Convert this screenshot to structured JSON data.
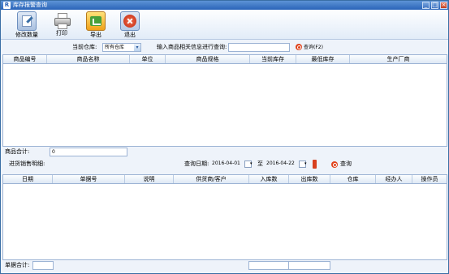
{
  "window": {
    "title": "库存报警查询"
  },
  "toolbar": {
    "edit_label": "修改数量",
    "print_label": "打印",
    "export_label": "导出",
    "exit_label": "退出"
  },
  "filter": {
    "warehouse_label": "当前仓库:",
    "warehouse_value": "所有仓库",
    "search_prompt": "输入商品相关信息进行查询:",
    "search_value": "",
    "search_button": "查询(F2)"
  },
  "product_table": {
    "columns": [
      "商品编号",
      "商品名称",
      "单位",
      "商品规格",
      "当前库存",
      "最低库存",
      "生产厂商"
    ],
    "total_label": "商品合计:",
    "total_value": "0"
  },
  "detail_section": {
    "title": "进货销售明细:",
    "date_label": "查询日期:",
    "date_from": "2016-04-01",
    "to_label": "至",
    "date_to": "2016-04-22",
    "query_button": "查询"
  },
  "detail_table": {
    "columns": [
      "日期",
      "单据号",
      "说明",
      "供货商/客户",
      "入库数",
      "出库数",
      "仓库",
      "经办人",
      "操作员"
    ],
    "total_label": "单据合计:",
    "total_value": ""
  }
}
